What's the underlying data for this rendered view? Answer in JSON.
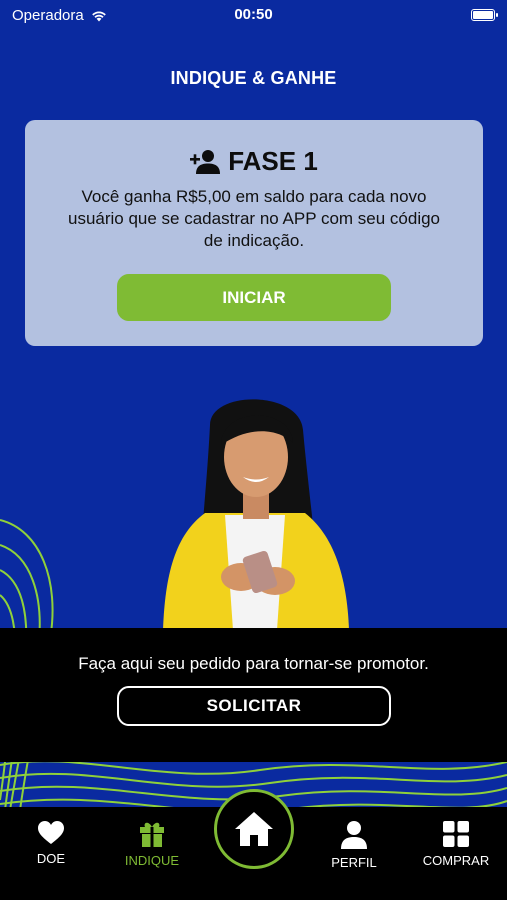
{
  "status_bar": {
    "carrier": "Operadora",
    "time": "00:50"
  },
  "header": {
    "title": "INDIQUE & GANHE"
  },
  "phase_card": {
    "title": "FASE 1",
    "description": "Você ganha R$5,00 em saldo para cada novo usuário que se cadastrar no APP com seu código de indicação.",
    "start_label": "INICIAR"
  },
  "promoter": {
    "text": "Faça aqui seu pedido para tornar-se promotor.",
    "request_label": "SOLICITAR"
  },
  "nav": {
    "items": [
      {
        "label": "DOE",
        "icon": "heart-icon"
      },
      {
        "label": "INDIQUE",
        "icon": "gift-icon",
        "active": true
      },
      {
        "label": "",
        "icon": "home-icon"
      },
      {
        "label": "PERFIL",
        "icon": "user-icon"
      },
      {
        "label": "COMPRAR",
        "icon": "grid-icon"
      }
    ]
  },
  "colors": {
    "background": "#0a2aa0",
    "card": "#b3c1e0",
    "accent": "#7fbb34",
    "banner": "#000000"
  }
}
